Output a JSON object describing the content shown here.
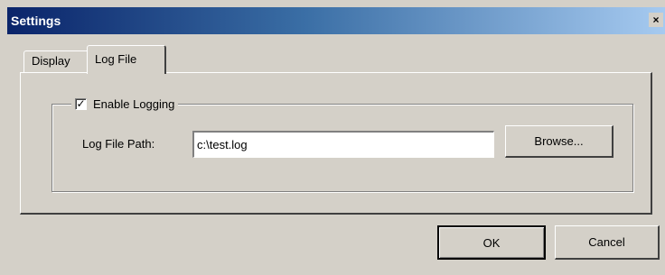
{
  "window": {
    "title": "Settings",
    "close_glyph": "×"
  },
  "tabs": [
    {
      "label": "Display",
      "active": false
    },
    {
      "label": "Log File",
      "active": true
    }
  ],
  "logging": {
    "group_label": "Enable Logging",
    "enabled": true,
    "check_glyph": "✓",
    "path_label": "Log File Path:",
    "path_value": "c:\\test.log",
    "browse_label": "Browse..."
  },
  "buttons": {
    "ok": "OK",
    "cancel": "Cancel"
  }
}
